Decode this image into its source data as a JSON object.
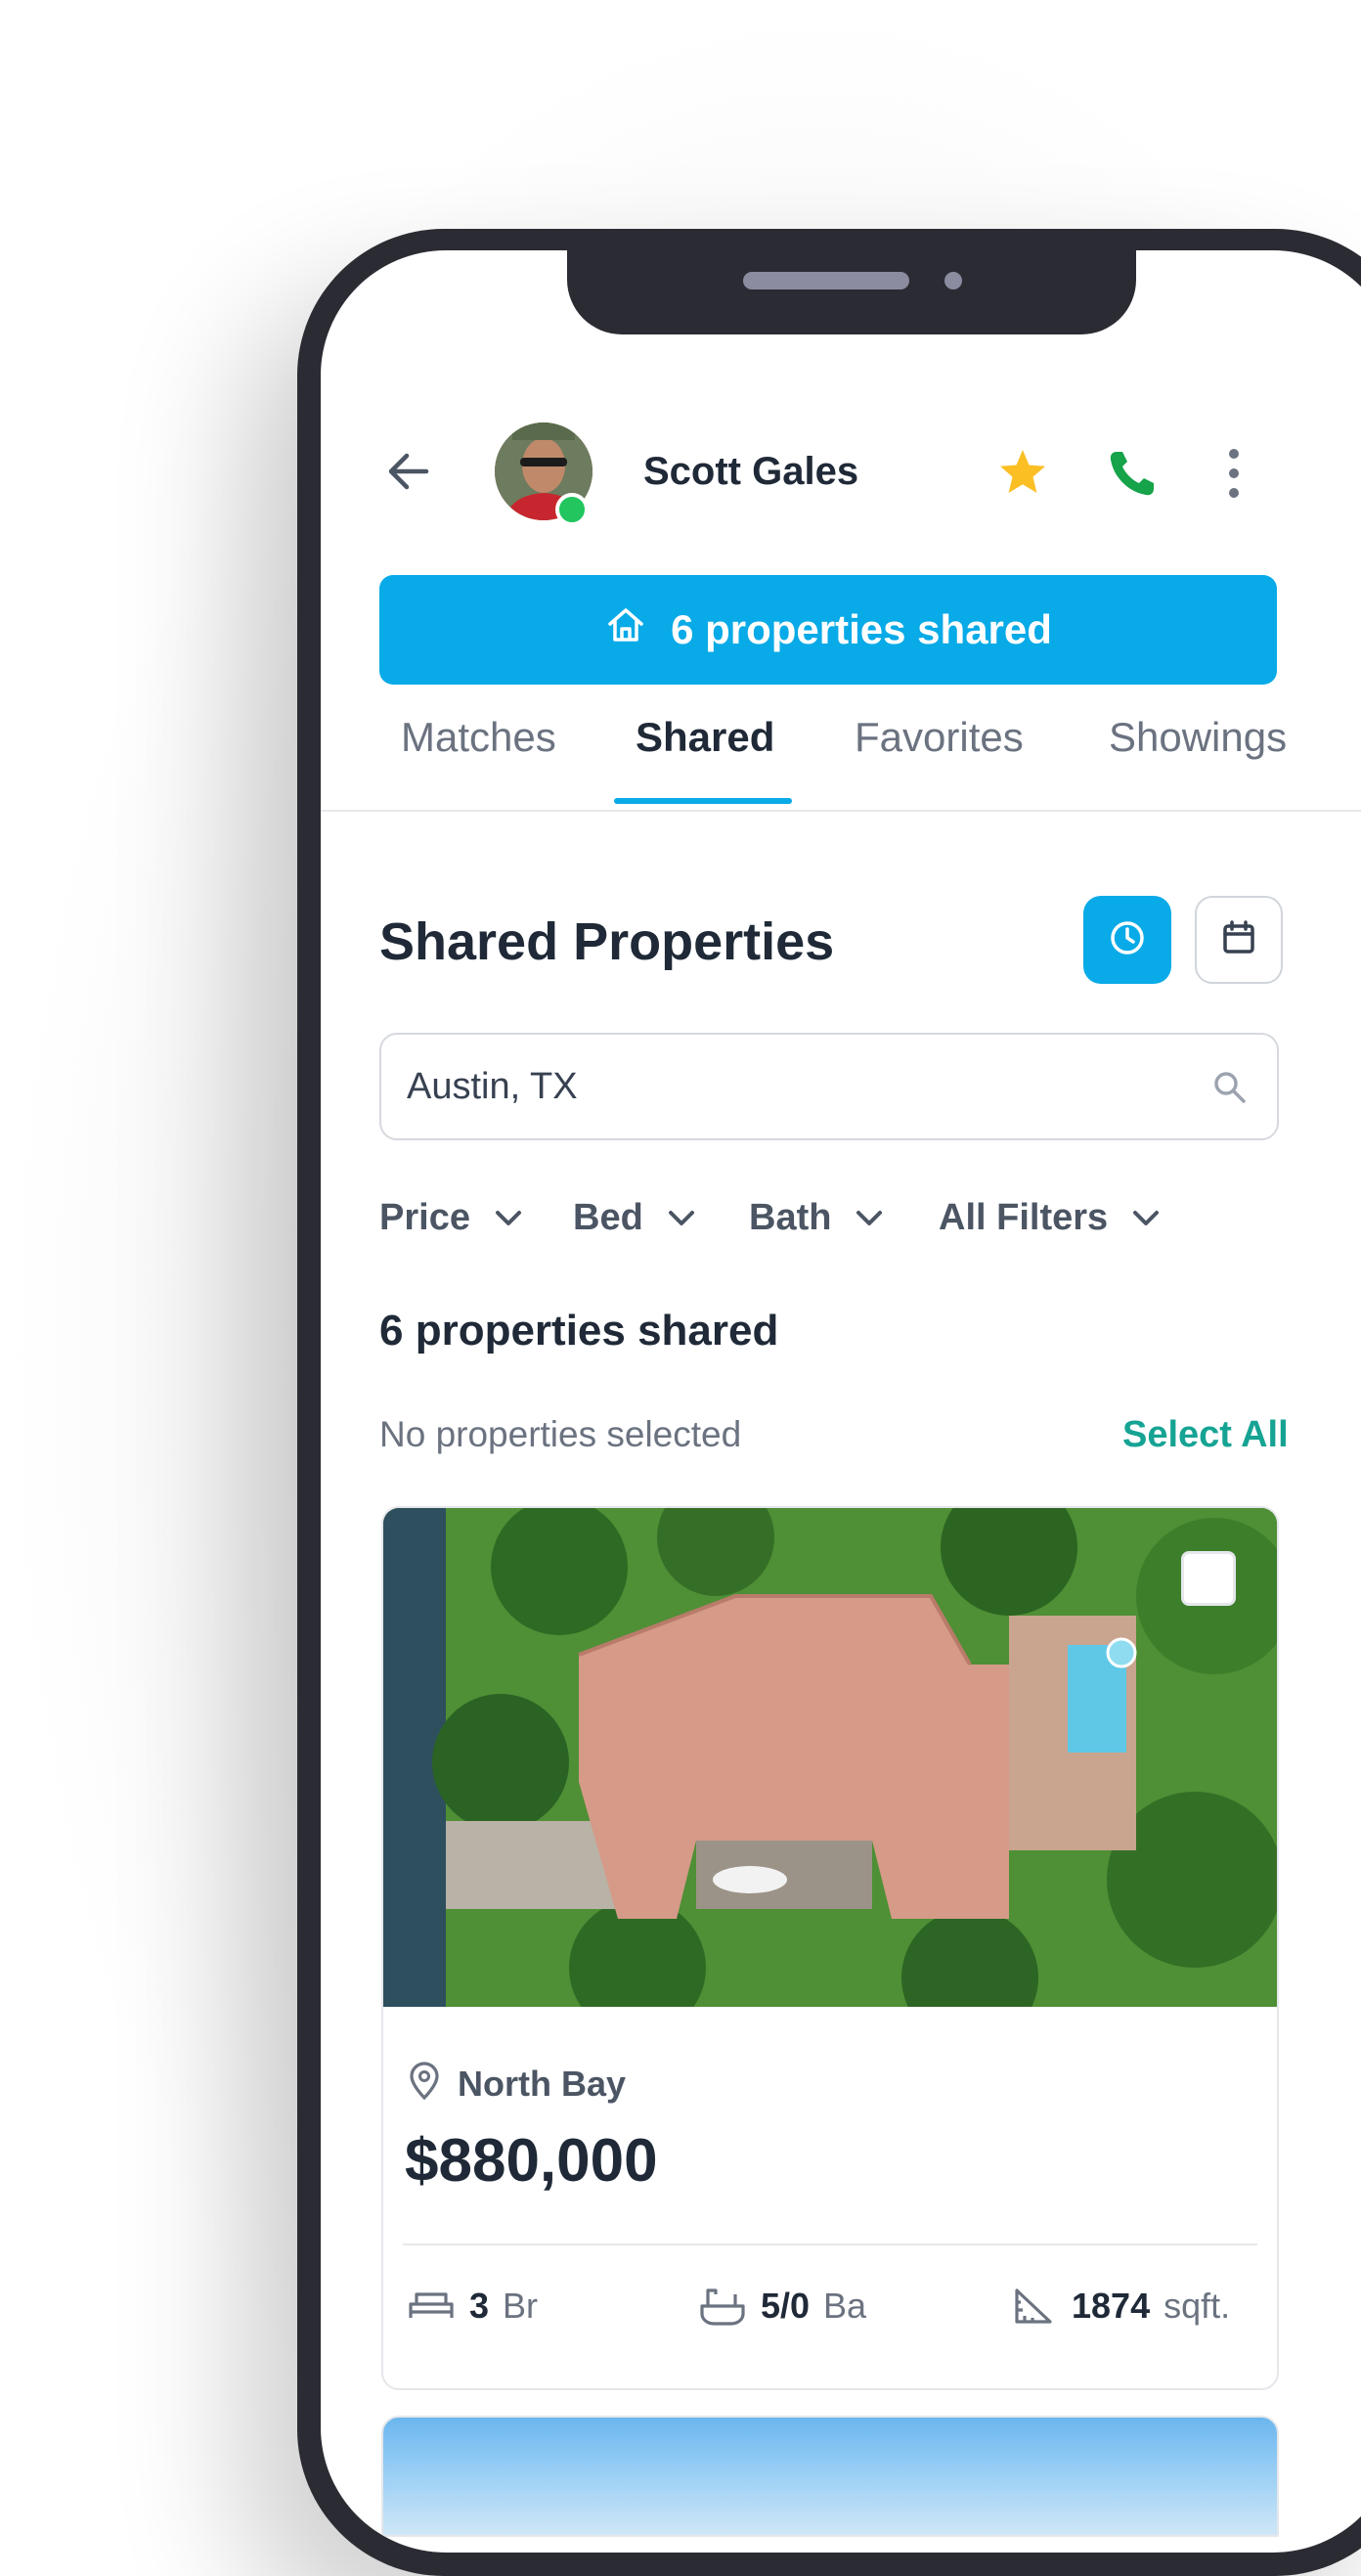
{
  "contact": {
    "name": "Scott Gales",
    "online": true
  },
  "banner": {
    "label": "6 properties shared"
  },
  "tabs": [
    {
      "label": "Matches",
      "active": false
    },
    {
      "label": "Shared",
      "active": true
    },
    {
      "label": "Favorites",
      "active": false
    },
    {
      "label": "Showings",
      "active": false
    }
  ],
  "section": {
    "title": "Shared Properties"
  },
  "search": {
    "value": "Austin, TX"
  },
  "filters": [
    {
      "label": "Price"
    },
    {
      "label": "Bed"
    },
    {
      "label": "Bath"
    },
    {
      "label": "All Filters"
    }
  ],
  "results": {
    "count_label": "6 properties shared",
    "selection_label": "No properties selected",
    "select_all": "Select All"
  },
  "property": {
    "location": "North Bay",
    "price": "$880,000",
    "beds": "3",
    "beds_unit": "Br",
    "baths": "5/0",
    "baths_unit": "Ba",
    "area": "1874",
    "area_unit": "sqft."
  },
  "colors": {
    "accent": "#08aae7",
    "select_all": "#16a394",
    "star": "#fbbf24",
    "call": "#16a34a",
    "online": "#22c55e"
  },
  "icons": [
    "back-arrow-icon",
    "star-icon",
    "phone-icon",
    "more-vertical-icon",
    "home-icon",
    "clock-icon",
    "calendar-icon",
    "search-icon",
    "chevron-down-icon",
    "location-pin-icon",
    "bed-icon",
    "bath-icon",
    "area-icon"
  ]
}
